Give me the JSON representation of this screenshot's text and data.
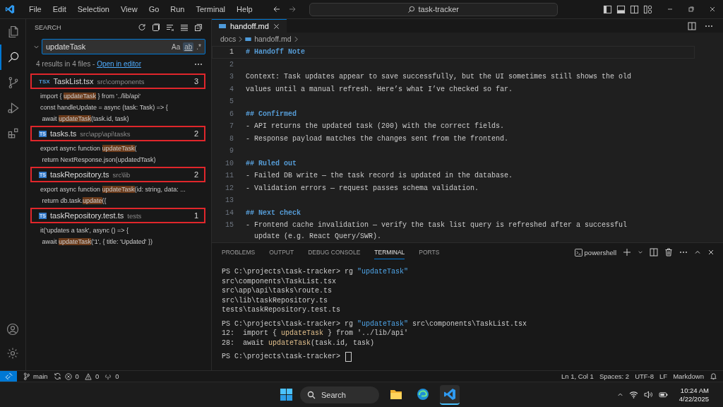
{
  "window": {
    "menus": [
      "File",
      "Edit",
      "Selection",
      "View",
      "Go",
      "Run",
      "Terminal",
      "Help"
    ],
    "command_center": "task-tracker"
  },
  "activity_bar": {
    "items": [
      {
        "kind": "explorer",
        "selected": false
      },
      {
        "kind": "search",
        "selected": true
      },
      {
        "kind": "source-control",
        "selected": false
      },
      {
        "kind": "run",
        "selected": false
      },
      {
        "kind": "extensions",
        "selected": false
      }
    ]
  },
  "sidebar": {
    "title": "SEARCH",
    "search": {
      "value": "updateTask",
      "options": [
        {
          "label": "Aa",
          "selected": false
        },
        {
          "label": "ab",
          "selected": true
        },
        {
          "label": ".*",
          "selected": false
        }
      ]
    },
    "summary": "4 results in 4 files - ",
    "summary_link": "Open in editor",
    "files": [
      {
        "badge": {
          "text": "TSX",
          "kind": "plain"
        },
        "name": "TaskList.tsx",
        "path": "src\\components",
        "count": "3",
        "outlined": true,
        "matches": [
          [
            {
              "text": "import { ",
              "kind": "plain"
            },
            {
              "text": "updateTask",
              "kind": "match"
            },
            {
              "text": " } from '../lib/api'",
              "kind": "plain"
            }
          ],
          [
            {
              "text": "const handleUpdate = async (task: Task) => {",
              "kind": "plain"
            }
          ],
          [
            {
              "text": " await ",
              "kind": "plain"
            },
            {
              "text": "updateTask",
              "kind": "match"
            },
            {
              "text": "(task.id, task)",
              "kind": "plain"
            }
          ]
        ]
      },
      {
        "badge": {
          "text": "TS",
          "kind": "boxed"
        },
        "name": "tasks.ts",
        "path": "src\\app\\api\\tasks",
        "count": "2",
        "outlined": true,
        "matches": [
          [
            {
              "text": "export async function ",
              "kind": "plain"
            },
            {
              "text": "updateTask",
              "kind": "match"
            },
            {
              "text": "(",
              "kind": "plain"
            }
          ],
          [
            {
              "text": " return NextResponse.json(updatedTask)",
              "kind": "plain"
            }
          ]
        ]
      },
      {
        "badge": {
          "text": "TS",
          "kind": "boxed"
        },
        "name": "taskRepository.ts",
        "path": "src\\lib",
        "count": "2",
        "outlined": true,
        "matches": [
          [
            {
              "text": "export async function ",
              "kind": "plain"
            },
            {
              "text": "updateTask",
              "kind": "match"
            },
            {
              "text": "(id: string, data: ...",
              "kind": "plain"
            }
          ],
          [
            {
              "text": " return db.task.",
              "kind": "plain"
            },
            {
              "text": "update",
              "kind": "match"
            },
            {
              "text": "({",
              "kind": "plain"
            }
          ]
        ]
      },
      {
        "badge": {
          "text": "TS",
          "kind": "boxed"
        },
        "name": "taskRepository.test.ts",
        "path": "tests",
        "count": "1",
        "outlined": true,
        "matches": [
          [
            {
              "text": "it('updates a task', async () => {",
              "kind": "plain"
            }
          ],
          [
            {
              "text": " await ",
              "kind": "plain"
            },
            {
              "text": "updateTask",
              "kind": "match"
            },
            {
              "text": "('1', { title: 'Updated' })",
              "kind": "plain"
            }
          ]
        ]
      }
    ]
  },
  "editor": {
    "tabs": [
      {
        "label": "handoff.md",
        "selected": true
      }
    ],
    "breadcrumbs": [
      "docs",
      "handoff.md"
    ],
    "lines": [
      {
        "num": "1",
        "kind": "heading",
        "text": "# Handoff Note",
        "current": true
      },
      {
        "num": "2",
        "kind": "blank",
        "current": false
      },
      {
        "num": "3",
        "kind": "text",
        "text": "Context: Task updates appear to save successfully, but the UI sometimes still shows the old",
        "current": false
      },
      {
        "num": "4",
        "kind": "text",
        "text": "values until a manual refresh. Here’s what I’ve checked so far.",
        "current": false
      },
      {
        "num": "5",
        "kind": "blank",
        "current": false
      },
      {
        "num": "6",
        "kind": "heading",
        "text": "## Confirmed",
        "current": false
      },
      {
        "num": "7",
        "kind": "text",
        "text": "- API returns the updated task (200) with the correct fields.",
        "current": false
      },
      {
        "num": "8",
        "kind": "text",
        "text": "- Response payload matches the changes sent from the frontend.",
        "current": false
      },
      {
        "num": "9",
        "kind": "blank",
        "current": false
      },
      {
        "num": "10",
        "kind": "heading",
        "text": "## Ruled out",
        "current": false
      },
      {
        "num": "11",
        "kind": "text",
        "text": "- Failed DB write — the task record is updated in the database.",
        "current": false
      },
      {
        "num": "12",
        "kind": "text",
        "text": "- Validation errors — request passes schema validation.",
        "current": false
      },
      {
        "num": "13",
        "kind": "blank",
        "current": false
      },
      {
        "num": "14",
        "kind": "heading",
        "text": "## Next check",
        "current": false
      },
      {
        "num": "15",
        "kind": "text",
        "text": "- Frontend cache invalidation — verify the task list query is refreshed after a successful update (e.g. React Query/SWR).",
        "current": false
      }
    ]
  },
  "panel": {
    "tabs": [
      {
        "label": "PROBLEMS",
        "selected": false
      },
      {
        "label": "OUTPUT",
        "selected": false
      },
      {
        "label": "DEBUG CONSOLE",
        "selected": false
      },
      {
        "label": "TERMINAL",
        "selected": true
      },
      {
        "label": "PORTS",
        "selected": false
      }
    ],
    "shell": "powershell",
    "blocks": [
      [
        {
          "parts": [
            {
              "text": "PS C:\\projects\\task-tracker> rg ",
              "kind": "plain"
            },
            {
              "text": "\"updateTask\"",
              "kind": "string"
            }
          ],
          "cursor": false
        },
        {
          "parts": [
            {
              "text": "src\\components\\TaskList.tsx",
              "kind": "plain"
            }
          ],
          "cursor": false
        },
        {
          "parts": [
            {
              "text": "src\\app\\api\\tasks\\route.ts",
              "kind": "plain"
            }
          ],
          "cursor": false
        },
        {
          "parts": [
            {
              "text": "src\\lib\\taskRepository.ts",
              "kind": "plain"
            }
          ],
          "cursor": false
        },
        {
          "parts": [
            {
              "text": "tests\\taskRepository.test.ts",
              "kind": "plain"
            }
          ],
          "cursor": false
        }
      ],
      [
        {
          "parts": [
            {
              "text": "PS C:\\projects\\task-tracker> rg ",
              "kind": "plain"
            },
            {
              "text": "\"updateTask\"",
              "kind": "string"
            },
            {
              "text": " src\\components\\TaskList.tsx",
              "kind": "plain"
            }
          ],
          "cursor": false
        },
        {
          "parts": [
            {
              "text": "12:  import { ",
              "kind": "plain"
            },
            {
              "text": "updateTask",
              "kind": "match"
            },
            {
              "text": " } from '../lib/api'",
              "kind": "plain"
            }
          ],
          "cursor": false
        },
        {
          "parts": [
            {
              "text": "28:  await ",
              "kind": "plain"
            },
            {
              "text": "updateTask",
              "kind": "match"
            },
            {
              "text": "(task.id, task)",
              "kind": "plain"
            }
          ],
          "cursor": false
        }
      ],
      [
        {
          "parts": [
            {
              "text": "PS C:\\projects\\task-tracker> ",
              "kind": "plain"
            }
          ],
          "cursor": true
        }
      ]
    ]
  },
  "status_bar": {
    "branch": "main",
    "errors": "0",
    "warnings": "0",
    "ports": "0",
    "items": [
      "Ln 1, Col 1",
      "Spaces: 2",
      "UTF-8",
      "LF",
      "Markdown"
    ]
  },
  "taskbar": {
    "search": "Search",
    "apps": [
      {
        "kind": "folder",
        "selected": false
      },
      {
        "kind": "edge",
        "selected": false
      },
      {
        "kind": "vscode",
        "selected": true
      }
    ],
    "time": "10:24 AM",
    "date": "4/22/2025"
  }
}
